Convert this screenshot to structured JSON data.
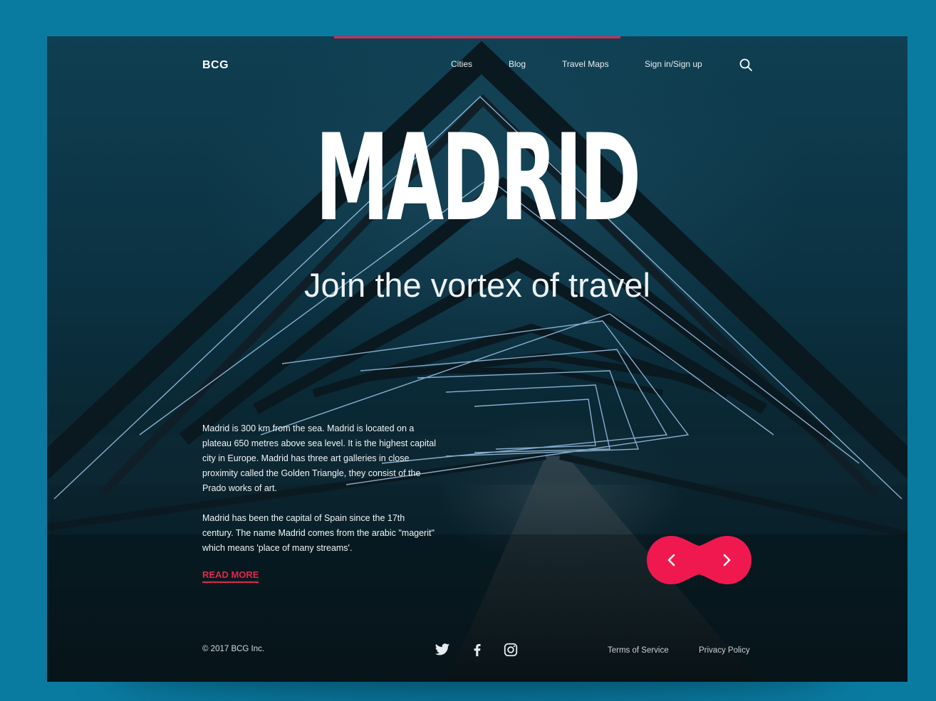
{
  "brand": {
    "logo": "BCG",
    "accent_color": "#e0274f",
    "background_color": "#0a7ba0"
  },
  "nav": {
    "items": [
      {
        "label": "Cities"
      },
      {
        "label": "Blog"
      },
      {
        "label": "Travel Maps"
      },
      {
        "label": "Sign in/Sign up"
      }
    ],
    "search_icon": "search-icon"
  },
  "hero": {
    "title": "MADRID",
    "subtitle": "Join the vortex of travel"
  },
  "description": {
    "paragraph_1": "Madrid is 300 km from the sea. Madrid is located on a plateau 650 metres above sea level. It is the highest capital city in Europe. Madrid has three art galleries in close proximity called the Golden Triangle, they consist of the Prado works of art.",
    "paragraph_2": "Madrid has been the capital of Spain since the 17th century. The name Madrid comes from the arabic \"magerit\" which means 'place of many streams'.",
    "read_more": "READ MORE"
  },
  "slider": {
    "prev_icon": "chevron-left-icon",
    "next_icon": "chevron-right-icon"
  },
  "footer": {
    "copyright": "© 2017 BCG Inc.",
    "social": [
      "twitter-icon",
      "facebook-icon",
      "instagram-icon"
    ],
    "links": [
      {
        "label": "Terms of Service"
      },
      {
        "label": "Privacy Policy"
      }
    ]
  }
}
